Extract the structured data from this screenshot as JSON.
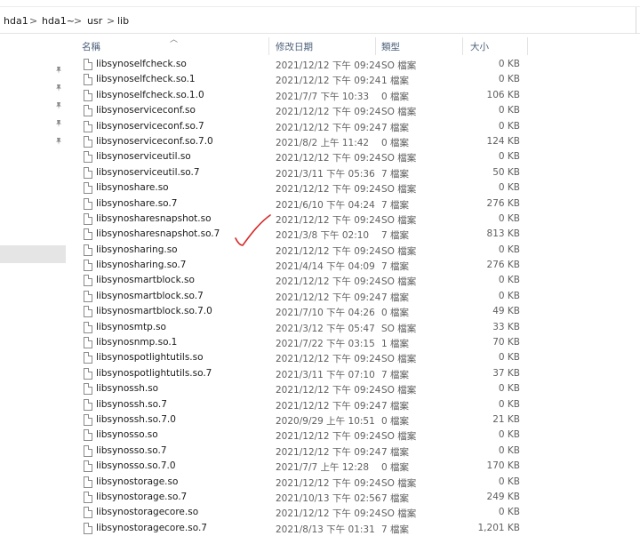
{
  "breadcrumb": {
    "items": [
      "hda1",
      "hda1~",
      "usr",
      "lib"
    ],
    "separator": ">"
  },
  "columns": {
    "name": "名稱",
    "date": "修改日期",
    "type": "類型",
    "size": "大小"
  },
  "icons": {
    "pin": "pin-icon",
    "file": "file-icon",
    "sort": "sort-up-arrow-icon"
  },
  "files": [
    {
      "name": "libsynoselfcheck.so",
      "date": "2021/12/12 下午 09:24",
      "type": "SO 檔案",
      "size": "0 KB"
    },
    {
      "name": "libsynoselfcheck.so.1",
      "date": "2021/12/12 下午 09:24",
      "type": "1 檔案",
      "size": "0 KB"
    },
    {
      "name": "libsynoselfcheck.so.1.0",
      "date": "2021/7/7 下午 10:33",
      "type": "0 檔案",
      "size": "106 KB"
    },
    {
      "name": "libsynoserviceconf.so",
      "date": "2021/12/12 下午 09:24",
      "type": "SO 檔案",
      "size": "0 KB"
    },
    {
      "name": "libsynoserviceconf.so.7",
      "date": "2021/12/12 下午 09:24",
      "type": "7 檔案",
      "size": "0 KB"
    },
    {
      "name": "libsynoserviceconf.so.7.0",
      "date": "2021/8/2 上午 11:42",
      "type": "0 檔案",
      "size": "124 KB"
    },
    {
      "name": "libsynoserviceutil.so",
      "date": "2021/12/12 下午 09:24",
      "type": "SO 檔案",
      "size": "0 KB"
    },
    {
      "name": "libsynoserviceutil.so.7",
      "date": "2021/3/11 下午 05:36",
      "type": "7 檔案",
      "size": "50 KB"
    },
    {
      "name": "libsynoshare.so",
      "date": "2021/12/12 下午 09:24",
      "type": "SO 檔案",
      "size": "0 KB"
    },
    {
      "name": "libsynoshare.so.7",
      "date": "2021/6/10 下午 04:24",
      "type": "7 檔案",
      "size": "276 KB"
    },
    {
      "name": "libsynosharesnapshot.so",
      "date": "2021/12/12 下午 09:24",
      "type": "SO 檔案",
      "size": "0 KB"
    },
    {
      "name": "libsynosharesnapshot.so.7",
      "date": "2021/3/8 下午 02:10",
      "type": "7 檔案",
      "size": "813 KB"
    },
    {
      "name": "libsynosharing.so",
      "date": "2021/12/12 下午 09:24",
      "type": "SO 檔案",
      "size": "0 KB"
    },
    {
      "name": "libsynosharing.so.7",
      "date": "2021/4/14 下午 04:09",
      "type": "7 檔案",
      "size": "276 KB"
    },
    {
      "name": "libsynosmartblock.so",
      "date": "2021/12/12 下午 09:24",
      "type": "SO 檔案",
      "size": "0 KB"
    },
    {
      "name": "libsynosmartblock.so.7",
      "date": "2021/12/12 下午 09:24",
      "type": "7 檔案",
      "size": "0 KB"
    },
    {
      "name": "libsynosmartblock.so.7.0",
      "date": "2021/7/10 下午 04:26",
      "type": "0 檔案",
      "size": "49 KB"
    },
    {
      "name": "libsynosmtp.so",
      "date": "2021/3/12 下午 05:47",
      "type": "SO 檔案",
      "size": "33 KB"
    },
    {
      "name": "libsynosnmp.so.1",
      "date": "2021/7/22 下午 03:15",
      "type": "1 檔案",
      "size": "70 KB"
    },
    {
      "name": "libsynospotlightutils.so",
      "date": "2021/12/12 下午 09:24",
      "type": "SO 檔案",
      "size": "0 KB"
    },
    {
      "name": "libsynospotlightutils.so.7",
      "date": "2021/3/11 下午 07:10",
      "type": "7 檔案",
      "size": "37 KB"
    },
    {
      "name": "libsynossh.so",
      "date": "2021/12/12 下午 09:24",
      "type": "SO 檔案",
      "size": "0 KB"
    },
    {
      "name": "libsynossh.so.7",
      "date": "2021/12/12 下午 09:24",
      "type": "7 檔案",
      "size": "0 KB"
    },
    {
      "name": "libsynossh.so.7.0",
      "date": "2020/9/29 上午 10:51",
      "type": "0 檔案",
      "size": "21 KB"
    },
    {
      "name": "libsynosso.so",
      "date": "2021/12/12 下午 09:24",
      "type": "SO 檔案",
      "size": "0 KB"
    },
    {
      "name": "libsynosso.so.7",
      "date": "2021/12/12 下午 09:24",
      "type": "7 檔案",
      "size": "0 KB"
    },
    {
      "name": "libsynosso.so.7.0",
      "date": "2021/7/7 上午 12:28",
      "type": "0 檔案",
      "size": "170 KB"
    },
    {
      "name": "libsynostorage.so",
      "date": "2021/12/12 下午 09:24",
      "type": "SO 檔案",
      "size": "0 KB"
    },
    {
      "name": "libsynostorage.so.7",
      "date": "2021/10/13 下午 02:56",
      "type": "7 檔案",
      "size": "249 KB"
    },
    {
      "name": "libsynostoragecore.so",
      "date": "2021/12/12 下午 09:24",
      "type": "SO 檔案",
      "size": "0 KB"
    },
    {
      "name": "libsynostoragecore.so.7",
      "date": "2021/8/13 下午 01:31",
      "type": "7 檔案",
      "size": "1,201 KB"
    }
  ]
}
